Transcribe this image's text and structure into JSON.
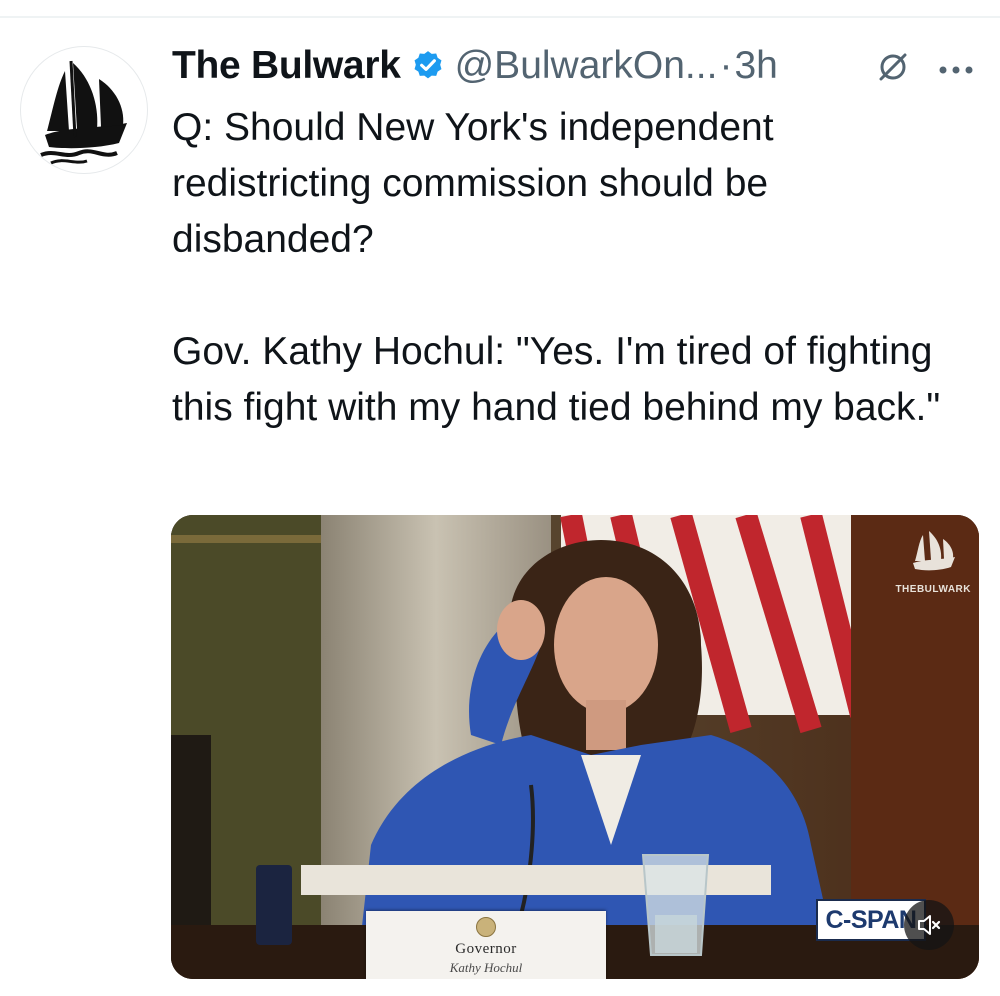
{
  "tweet": {
    "author_name": "The Bulwark",
    "handle": "@BulwarkOn...",
    "separator": "·",
    "time": "3h",
    "question": "Q: Should New York's independent redistricting commission should be disbanded?",
    "quote": "Gov. Kathy Hochul: \"Yes. I'm tired of fighting this fight with my hand tied behind my back.\""
  },
  "media": {
    "watermark_text": "THEBULWARK",
    "network_label": "C-SPAN",
    "nameplate_title": "Governor",
    "nameplate_name": "Kathy Hochul"
  },
  "icons": {
    "verified": "verified-badge-icon",
    "grok": "grok-icon",
    "more": "more-icon",
    "mute": "mute-icon"
  },
  "colors": {
    "verified_blue": "#1d9bf0",
    "secondary_text": "#536471",
    "primary_text": "#0f1419"
  }
}
